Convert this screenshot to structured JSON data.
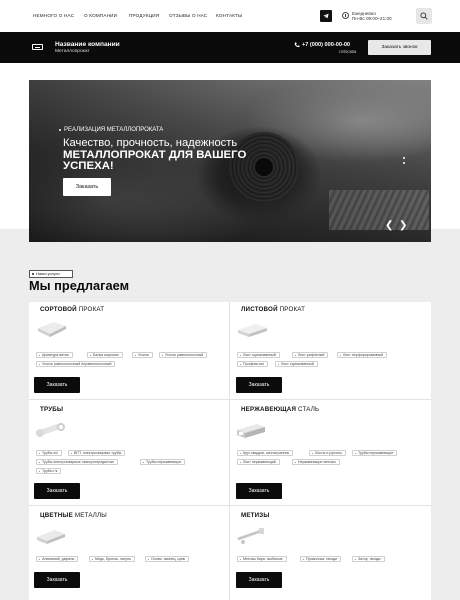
{
  "nav": {
    "items": [
      "Немного о нас",
      "О компании",
      "Продукция",
      "Отзывы о нас",
      "Контакты"
    ],
    "hours_label": "Ежедневно",
    "hours_value": "Пн-Вс 09:00–21:00"
  },
  "header": {
    "company_name": "Название компании",
    "company_sub": "Металлопрокат",
    "phone": "+7 (000) 000-00-00",
    "city": "г.Москва",
    "callback_label": "Заказать звонок"
  },
  "hero": {
    "tag": "Реализация металлопроката",
    "line1": "Качество, прочность, надежность",
    "line2": "металлопрокат для вашего",
    "line3": "успеха!",
    "button": "Заказать",
    "prev_arrow": "❮",
    "next_arrow": "❯"
  },
  "section": {
    "badge": "Наши услуги",
    "title": "Мы предлагаем"
  },
  "cards": [
    {
      "title_bold": "Сортовой",
      "title_rest": " прокат",
      "tags": [
        "Арматура витая",
        "Балка широкая",
        "Уголок",
        "Уголок равнополочный",
        "Уголок равнополочный неравнополочный"
      ],
      "button": "Заказать"
    },
    {
      "title_bold": "Листовой",
      "title_rest": " прокат",
      "tags": [
        "Лист оцинкованный",
        "Лист рифленый",
        "Лист перфорированный",
        "Профнастил",
        "Лист оцинкованный"
      ],
      "button": "Заказать"
    },
    {
      "title_bold": "Трубы",
      "title_rest": "",
      "tags": [
        "Трубы э/с",
        "ВГП, электросварные трубы",
        "Трубы электросварные низкоуглеродистые",
        "Трубы нержавеющие",
        "Трубы г/к"
      ],
      "button": "Заказать"
    },
    {
      "title_bold": "Нержавеющая",
      "title_rest": " сталь",
      "tags": [
        "Круг квадрат, шестигранник",
        "Листы и рулоны",
        "Трубы нержавеющие",
        "Лист нержавеющий",
        "Нержавеющие метизы"
      ],
      "button": "Заказать"
    },
    {
      "title_bold": "Цветные",
      "title_rest": " металлы",
      "tags": [
        "Алюминий, дюраль",
        "Медь, бронза, латунь",
        "Олово, свинец, цинк"
      ],
      "button": "Заказать"
    },
    {
      "title_bold": "Метизы",
      "title_rest": "",
      "tags": [
        "Метизы бара, скобяные",
        "Проволока, гвозди",
        "Затор, гвозди"
      ],
      "button": "Заказать"
    }
  ]
}
